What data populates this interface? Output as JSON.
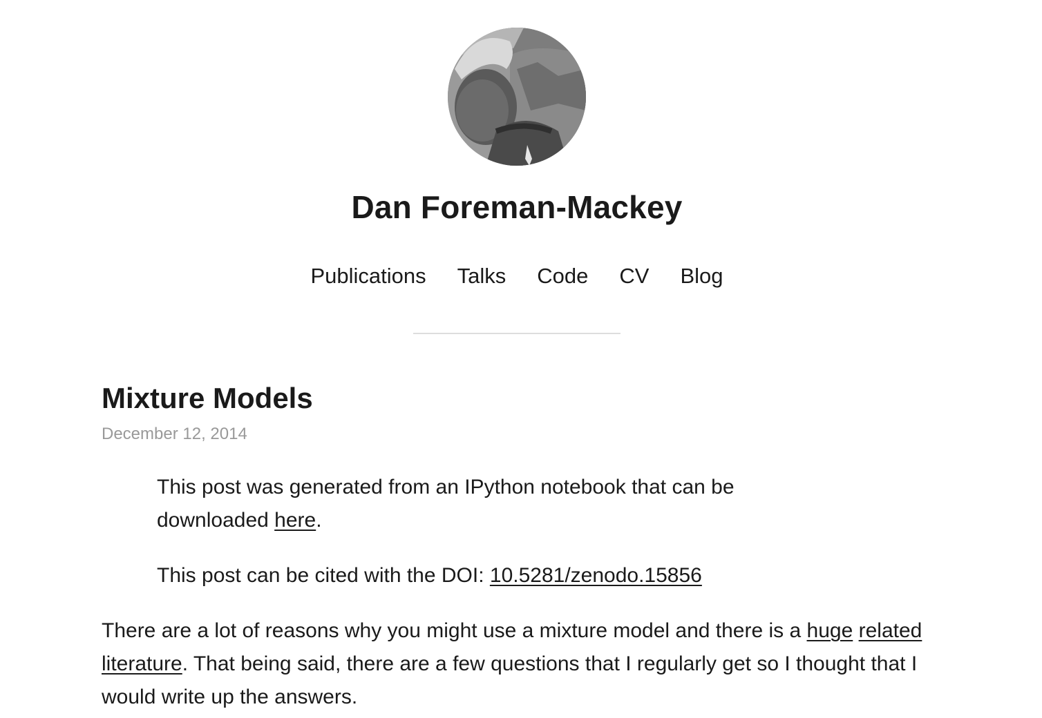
{
  "header": {
    "avatar_alt": "profile photo",
    "site_title": "Dan Foreman-Mackey"
  },
  "nav": {
    "items": [
      {
        "label": "Publications"
      },
      {
        "label": "Talks"
      },
      {
        "label": "Code"
      },
      {
        "label": "CV"
      },
      {
        "label": "Blog"
      }
    ]
  },
  "post": {
    "title": "Mixture Models",
    "date": "December 12, 2014",
    "note1": {
      "text": "This post was generated from an IPython notebook that can be downloaded ",
      "link": "here",
      "after": "."
    },
    "note2": {
      "text": "This post can be cited with the DOI: ",
      "link": "10.5281/zenodo.15856"
    },
    "intro": {
      "part1": "There are a lot of reasons why you might use a mixture model and there is a ",
      "link1": "huge",
      "space1": " ",
      "link2": "related",
      "space2": " ",
      "link3": "literature",
      "part2": ". That being said, there are a few questions that I regularly get so I thought that I would write up the answers."
    }
  }
}
